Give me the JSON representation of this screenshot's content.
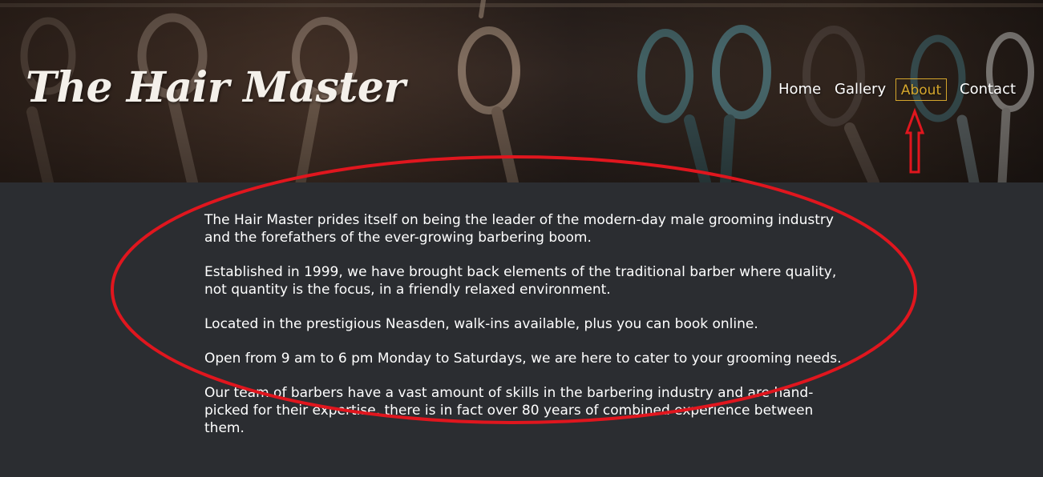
{
  "site": {
    "brand": "The Hair Master"
  },
  "nav": {
    "items": [
      "Home",
      "Gallery",
      "About",
      "Contact"
    ],
    "active": "About",
    "active_color": "#d4a52c"
  },
  "about": {
    "paragraphs": [
      "The Hair Master prides itself on being the leader of the modern-day male grooming industry and the forefathers of the ever-growing barbering boom.",
      "Established in 1999, we have brought back elements of the traditional barber where quality, not quantity is the focus, in a friendly relaxed environment.",
      "Located in the prestigious Neasden, walk-ins available, plus you can book online.",
      "Open from 9 am to 6 pm Monday to Saturdays, we are here to cater to your grooming needs.",
      "Our team of barbers have a vast amount of skills in the barbering industry and are hand-picked for their expertise, there is in fact over 80 years of combined experience between them."
    ]
  },
  "annotations": {
    "color": "#e0161e"
  },
  "theme": {
    "background": "#2b2d31",
    "text": "#ffffff"
  }
}
